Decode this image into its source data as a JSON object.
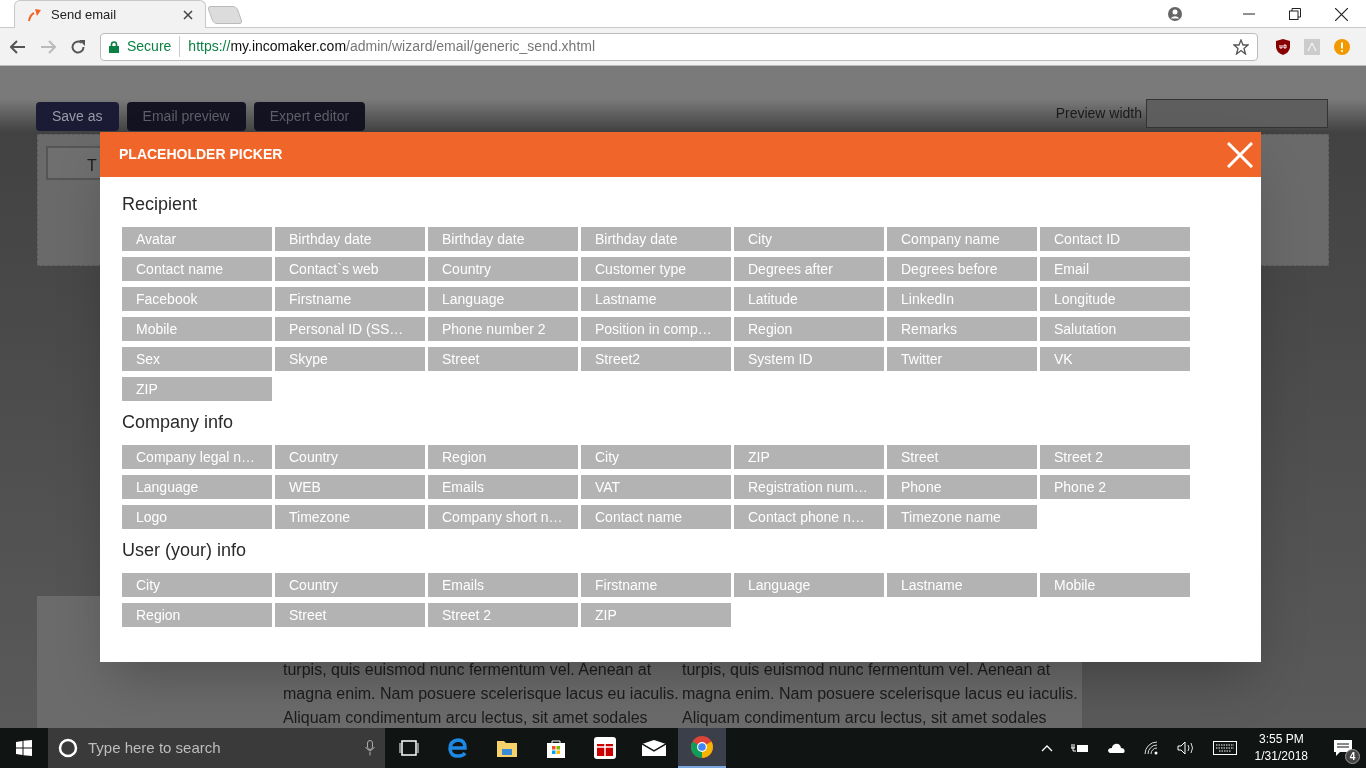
{
  "browser": {
    "tab_title": "Send email",
    "secure_label": "Secure",
    "url_scheme": "https://",
    "url_host": "my.incomaker.com",
    "url_path": "/admin/wizard/email/generic_send.xhtml"
  },
  "page": {
    "buttons": [
      "Save as",
      "Email preview",
      "Expert editor"
    ],
    "preview_width_label": "Preview width",
    "to_field_text": "T",
    "body_columns": [
      [
        "turpis, quis euismod nunc fermentum vel. Aenean at",
        "magna enim. Nam posuere scelerisque lacus eu iaculis.",
        "Aliquam condimentum arcu lectus, sit amet sodales"
      ],
      [
        "turpis, quis euismod nunc fermentum vel. Aenean at",
        "magna enim. Nam posuere scelerisque lacus eu iaculis.",
        "Aliquam condimentum arcu lectus, sit amet sodales"
      ]
    ]
  },
  "modal": {
    "title": "PLACEHOLDER PICKER",
    "sections": [
      {
        "heading": "Recipient",
        "items": [
          "Avatar",
          "Birthday date",
          "Birthday date",
          "Birthday date",
          "City",
          "Company name",
          "Contact ID",
          "Contact name",
          "Contact`s web",
          "Country",
          "Customer type",
          "Degrees after",
          "Degrees before",
          "Email",
          "Facebook",
          "Firstname",
          "Language",
          "Lastname",
          "Latitude",
          "LinkedIn",
          "Longitude",
          "Mobile",
          "Personal ID (SS…",
          "Phone number 2",
          "Position in comp…",
          "Region",
          "Remarks",
          "Salutation",
          "Sex",
          "Skype",
          "Street",
          "Street2",
          "System ID",
          "Twitter",
          "VK",
          "ZIP"
        ]
      },
      {
        "heading": "Company info",
        "items": [
          "Company legal n…",
          "Country",
          "Region",
          "City",
          "ZIP",
          "Street",
          "Street 2",
          "Language",
          "WEB",
          "Emails",
          "VAT",
          "Registration num…",
          "Phone",
          "Phone 2",
          "Logo",
          "Timezone",
          "Company short n…",
          "Contact name",
          "Contact phone n…",
          "Timezone name"
        ]
      },
      {
        "heading": "User (your) info",
        "items": [
          "City",
          "Country",
          "Emails",
          "Firstname",
          "Language",
          "Lastname",
          "Mobile",
          "Region",
          "Street",
          "Street 2",
          "ZIP"
        ]
      }
    ]
  },
  "taskbar": {
    "search_placeholder": "Type here to search",
    "time": "3:55 PM",
    "date": "1/31/2018",
    "notification_count": "4"
  }
}
